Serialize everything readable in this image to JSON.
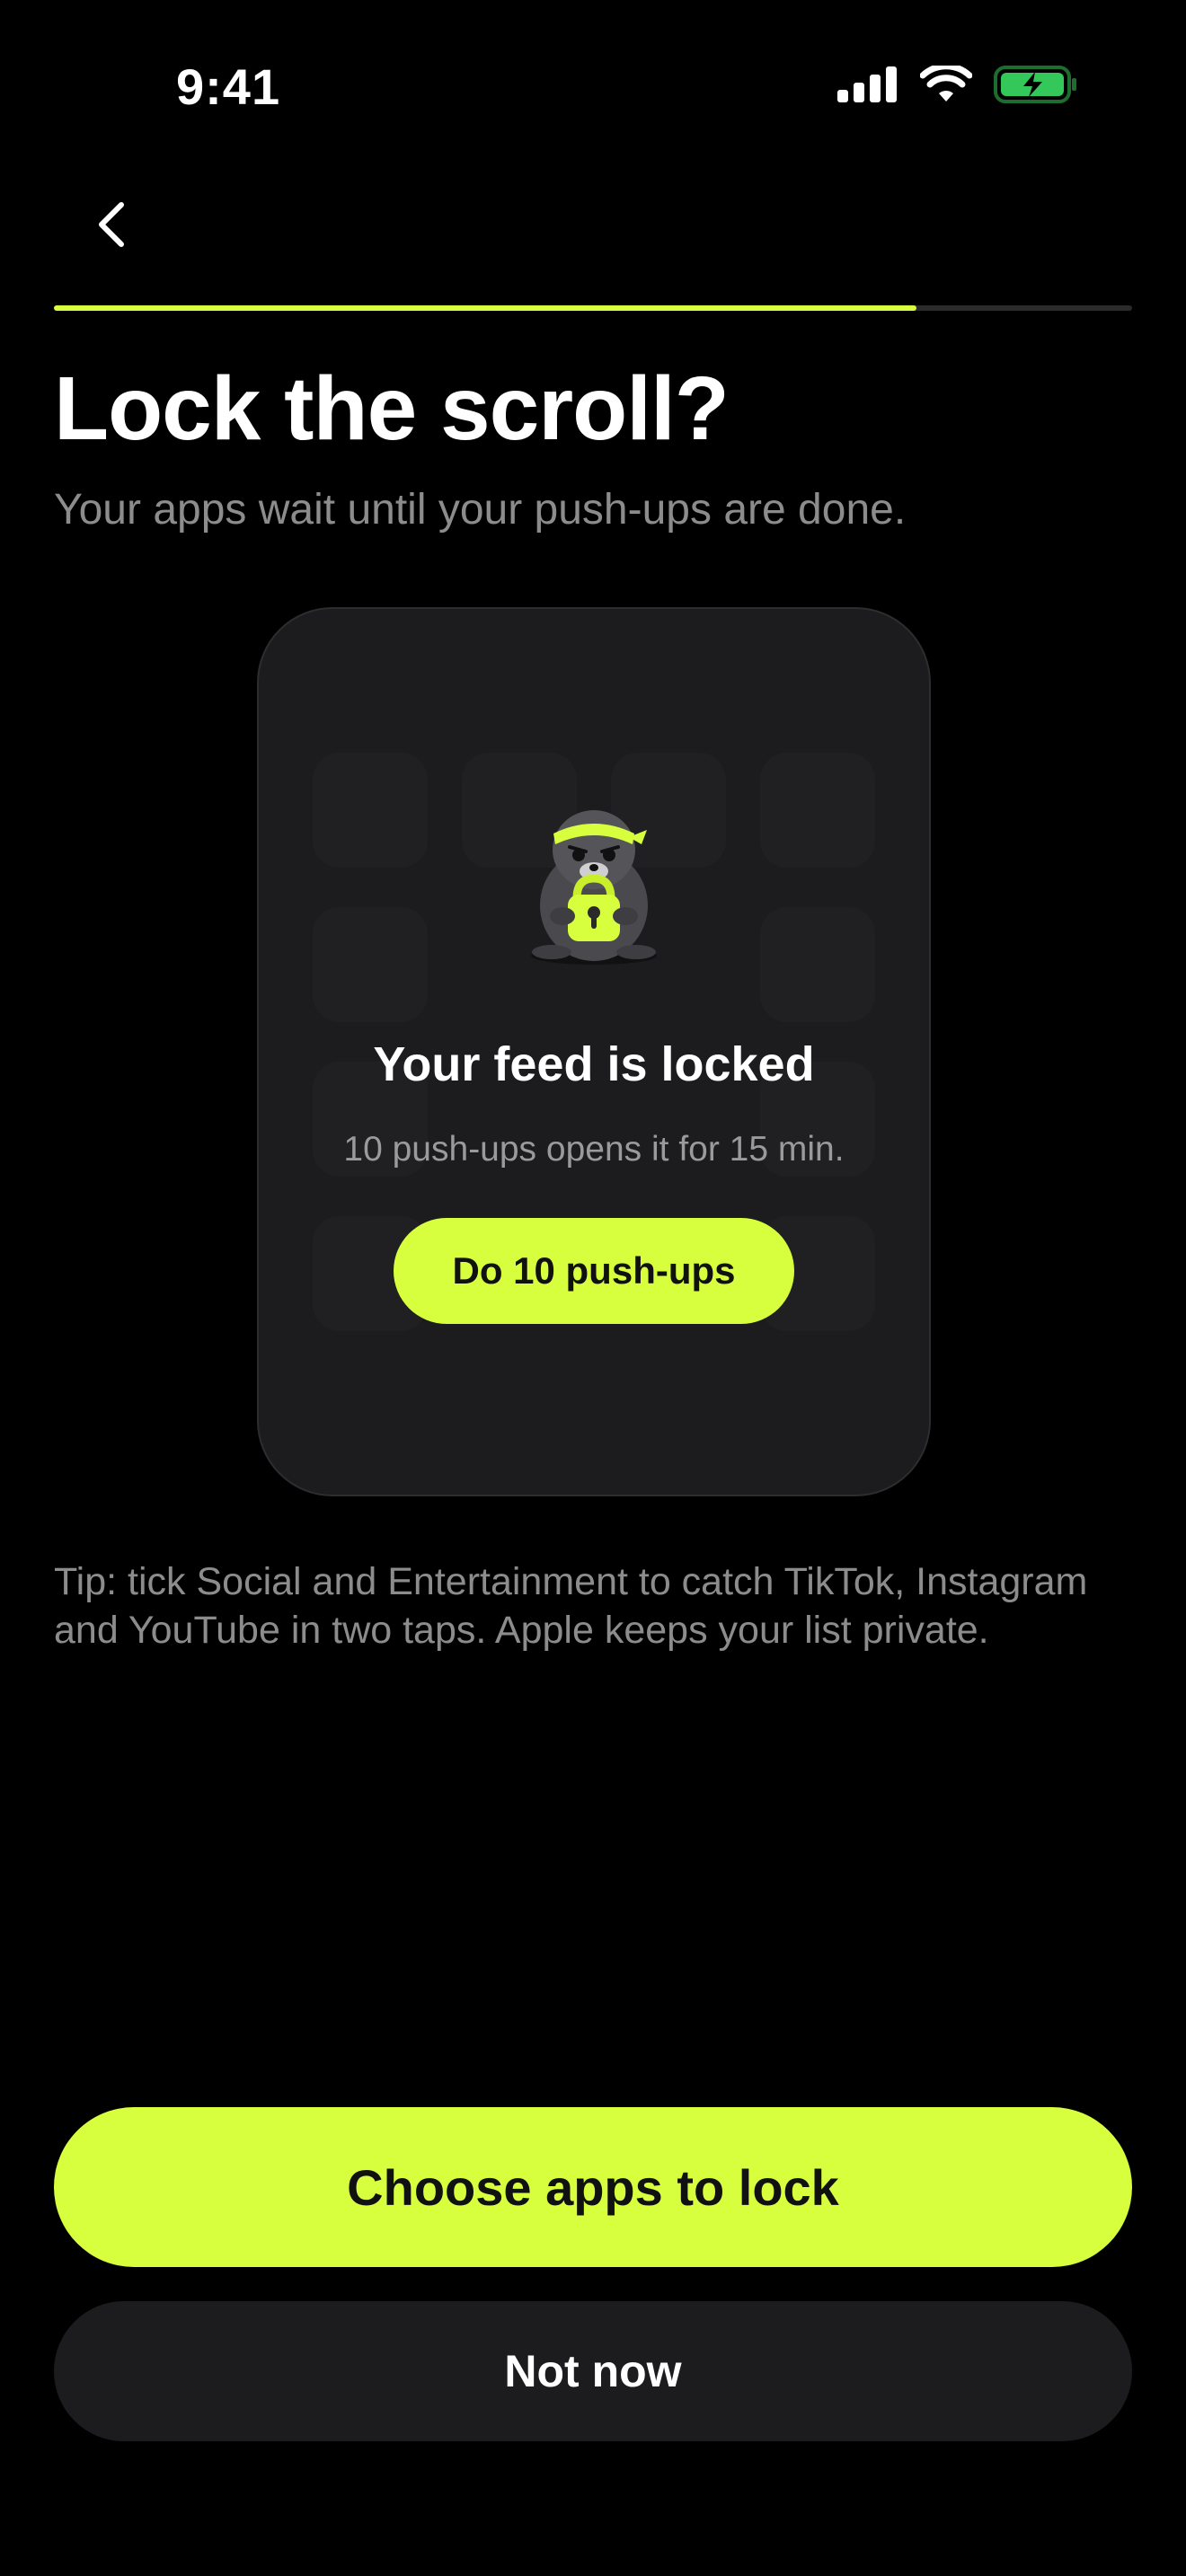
{
  "status_bar": {
    "time": "9:41",
    "icons": [
      "signal-icon",
      "wifi-icon",
      "battery-charging-icon"
    ],
    "battery_color": "#34c759"
  },
  "nav": {
    "back_icon": "chevron-left-icon"
  },
  "progress": {
    "fraction": 0.8,
    "fill_color": "#d8ff3e",
    "track_color": "#2b2b2b"
  },
  "header": {
    "title": "Lock the scroll?",
    "subtitle": "Your apps wait until your push-ups are done."
  },
  "preview_card": {
    "mascot": "seal-with-headband-holding-lock-icon",
    "title": "Your feed is locked",
    "subtitle": "10 push-ups opens it for 15 min.",
    "button_label": "Do 10 push-ups"
  },
  "tip": "Tip: tick Social and Entertainment to catch TikTok, Instagram and YouTube in two taps. Apple keeps your list private.",
  "actions": {
    "primary_label": "Choose apps to lock",
    "secondary_label": "Not now"
  },
  "colors": {
    "accent": "#d8ff3e",
    "background": "#000000",
    "surface": "#1c1c1e",
    "muted_text": "#8c8c8c"
  }
}
